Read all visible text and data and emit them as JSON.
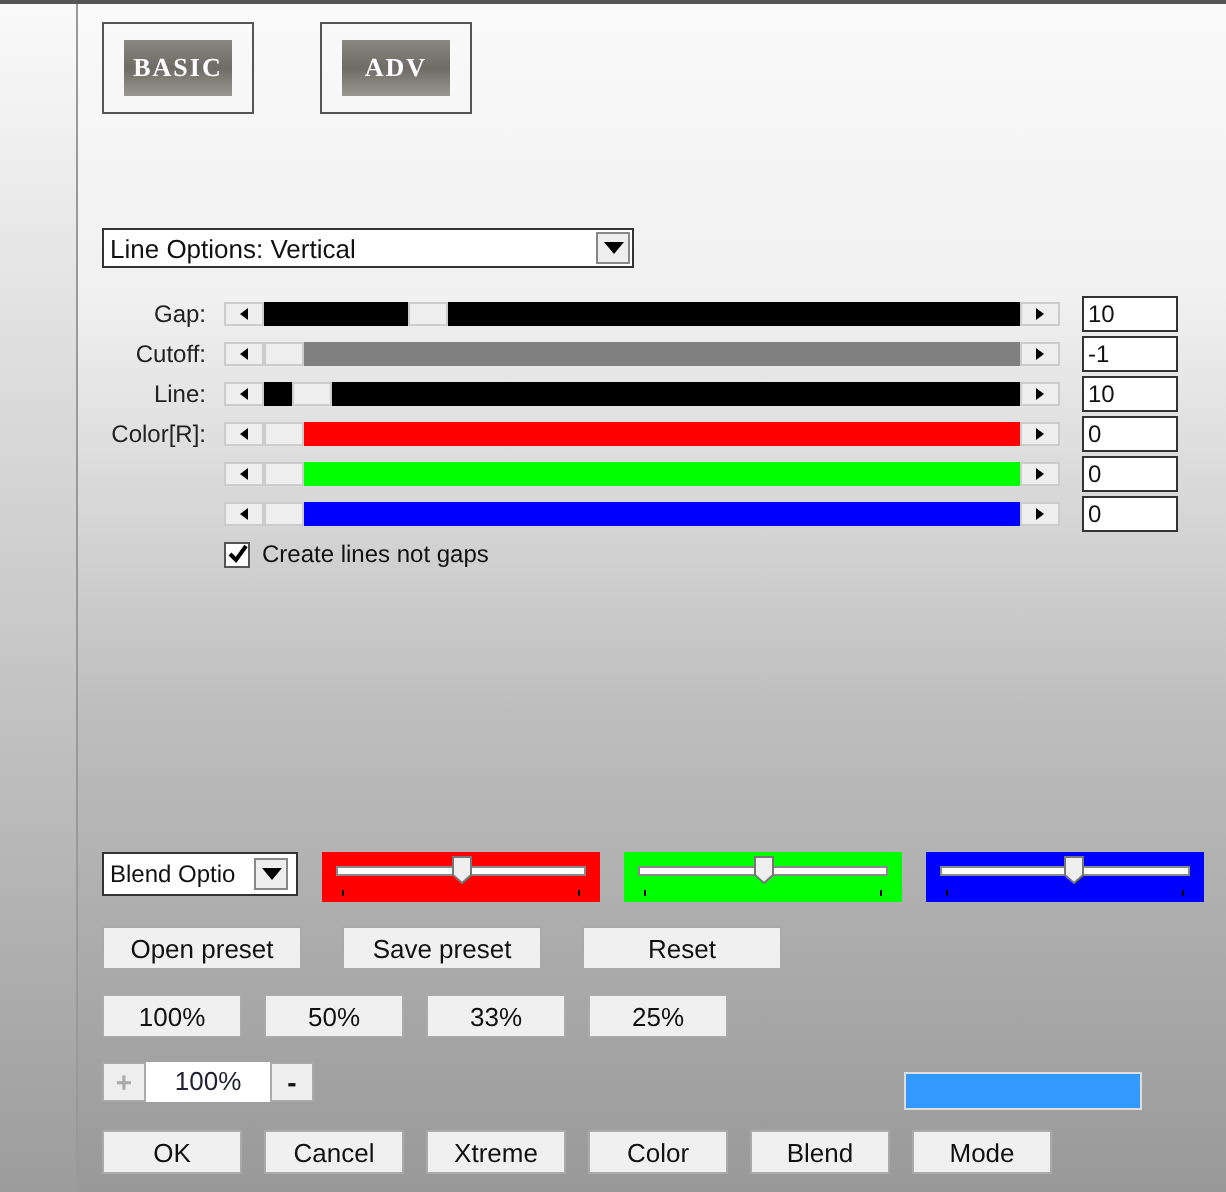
{
  "mode_tabs": [
    {
      "label": "BASIC"
    },
    {
      "label": "ADV"
    }
  ],
  "options_dropdown": {
    "value": "Line Options: Vertical"
  },
  "sliders": [
    {
      "label": "Gap:",
      "level": 0.2,
      "color": "#000000",
      "value": "10"
    },
    {
      "label": "Cutoff:",
      "level": 0,
      "color": "#808080",
      "value": "-1"
    },
    {
      "label": "Line:",
      "level": 0.04,
      "color": "#000000",
      "value": "10"
    },
    {
      "label": "Color[R]:",
      "level": 0,
      "color": "#ff0000",
      "value": "0"
    },
    {
      "level": 0,
      "color": "#00ff00",
      "value": "0"
    },
    {
      "level": 0,
      "color": "#0000ff",
      "value": "0"
    }
  ],
  "create_lines_checkbox": {
    "label": "Create lines not gaps",
    "checked": true
  },
  "blend_dropdown": {
    "value": "Blend Optio"
  },
  "color_sliders": [
    {
      "color": "#ff0000",
      "level": 0.5
    },
    {
      "color": "#00ff00",
      "level": 0.5
    },
    {
      "color": "#0000ff",
      "level": 0.54
    }
  ],
  "preset_buttons": [
    "Open preset",
    "Save preset",
    "Reset"
  ],
  "scale_buttons": [
    "100%",
    "50%",
    "33%",
    "25%"
  ],
  "zoom": {
    "plus": "+",
    "value": "100%",
    "minus": "-",
    "plus_disabled": true
  },
  "swatch": {
    "color": "#3399ff"
  },
  "action_buttons": [
    "OK",
    "Cancel",
    "Xtreme",
    "Color",
    "Blend",
    "Mode"
  ]
}
